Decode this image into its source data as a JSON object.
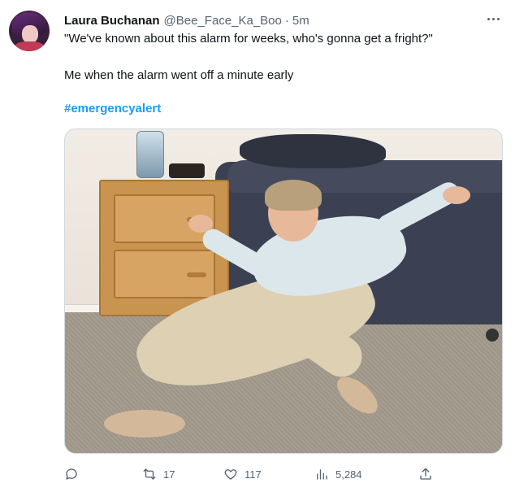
{
  "tweet": {
    "author_name": "Laura Buchanan",
    "handle": "@Bee_Face_Ka_Boo",
    "separator": "·",
    "time": "5m",
    "text_line1": "\"We've known about this alarm for weeks, who's gonna get a fright?\"",
    "text_line2": "Me when the alarm went off a minute early",
    "hashtag": "#emergencyalert"
  },
  "actions": {
    "reply_count": "",
    "retweet_count": "17",
    "like_count": "117",
    "views_count": "5,284"
  },
  "icons": {
    "more": "more-horizontal-icon",
    "reply": "reply-icon",
    "retweet": "retweet-icon",
    "like": "heart-icon",
    "views": "views-chart-icon",
    "share": "share-icon"
  },
  "colors": {
    "accent": "#1d9bf0",
    "secondary_text": "#536471",
    "primary_text": "#0f1419",
    "border": "#cfd9de"
  }
}
